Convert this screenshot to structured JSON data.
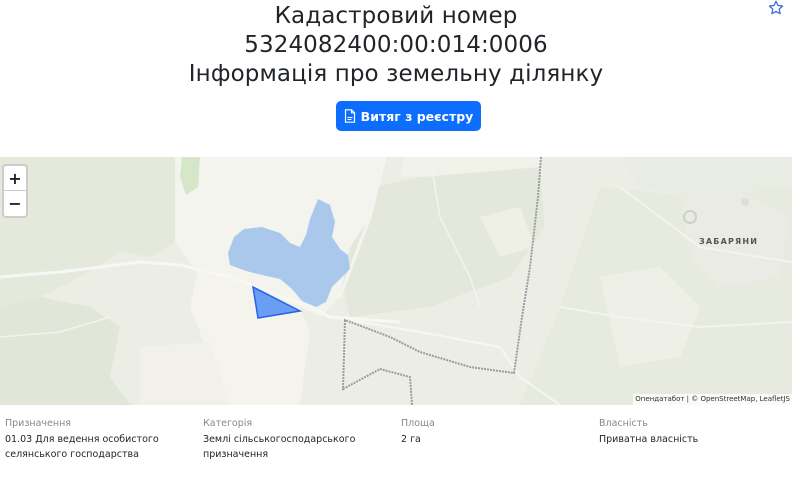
{
  "header": {
    "title_line1": "Кадастровий номер",
    "title_line2": "5324082400:00:014:0006",
    "title_line3": "Інформація про земельну ділянку",
    "extract_button_label": "Витяг з реєстру",
    "extract_button_icon": "pdf-file-icon",
    "favorite_icon": "star-outline-icon"
  },
  "map": {
    "zoom_in_label": "+",
    "zoom_out_label": "−",
    "village_label": "ЗАБАРЯНИ",
    "attribution": "Опендатабот | © OpenStreetMap, LeafletJS",
    "parcel_color": "#3b82f6",
    "water_color": "#aac8ec"
  },
  "info": {
    "purpose_label": "Призначення",
    "purpose_value_line1": "01.03 Для ведення особистого",
    "purpose_value_line2": "селянського господарства",
    "category_label": "Категорія",
    "category_value_line1": "Землі сільськогосподарського",
    "category_value_line2": "призначення",
    "area_label": "Площа",
    "area_value": "2 га",
    "ownership_label": "Власність",
    "ownership_value": "Приватна власність"
  },
  "colors": {
    "primary": "#0d6efd",
    "label_gray": "#888888"
  }
}
